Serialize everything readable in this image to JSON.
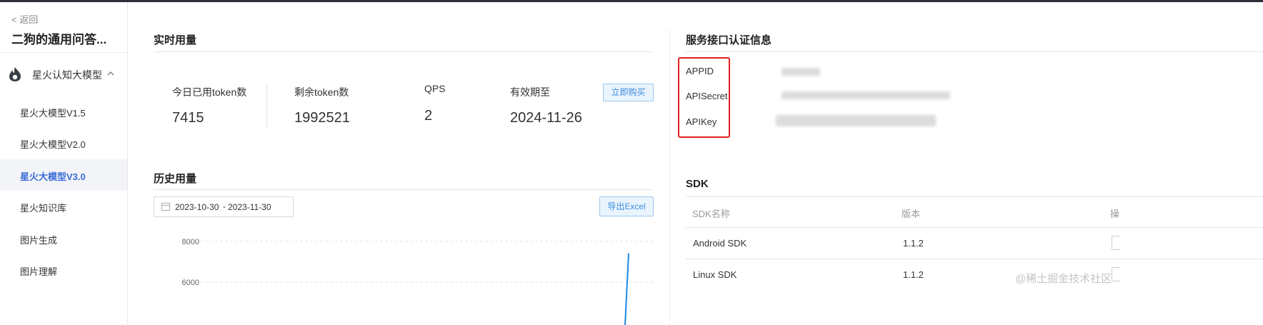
{
  "sidebar": {
    "back_label": "< 返回",
    "app_name": "二狗的通用问答...",
    "group": {
      "label": "星火认知大模型",
      "chevron": "^"
    },
    "items": [
      {
        "label": "星火大模型V1.5",
        "active": false
      },
      {
        "label": "星火大模型V2.0",
        "active": false
      },
      {
        "label": "星火大模型V3.0",
        "active": true
      },
      {
        "label": "星火知识库",
        "active": false
      },
      {
        "label": "图片生成",
        "active": false
      },
      {
        "label": "图片理解",
        "active": false
      }
    ]
  },
  "realtime": {
    "title": "实时用量",
    "stats": [
      {
        "label": "今日已用token数",
        "value": "7415"
      },
      {
        "label": "剩余token数",
        "value": "1992521"
      },
      {
        "label": "QPS",
        "value": "2"
      },
      {
        "label": "有效期至",
        "value": "2024-11-26"
      }
    ],
    "buy_label": "立即购买"
  },
  "history": {
    "title": "历史用量",
    "date_start": "2023-10-30",
    "date_sep": "-",
    "date_end": "2023-11-30",
    "export_label": "导出Excel"
  },
  "chart_data": {
    "type": "line",
    "yticks": [
      8000,
      6000
    ],
    "ylim": [
      0,
      8000
    ],
    "series": [
      {
        "values": [
          7415
        ]
      }
    ],
    "grid": true
  },
  "auth": {
    "title": "服务接口认证信息",
    "labels": [
      "APPID",
      "APISecret",
      "APIKey"
    ]
  },
  "sdk": {
    "title": "SDK",
    "columns": [
      "SDK名称",
      "版本",
      "操"
    ],
    "rows": [
      {
        "name": "Android SDK",
        "version": "1.1.2"
      },
      {
        "name": "Linux SDK",
        "version": "1.1.2"
      }
    ]
  },
  "watermark": "@稀土掘金技术社区",
  "colors": {
    "accent": "#3d6bd9",
    "highlight_box": "#e02020",
    "line": "#1e88e5"
  }
}
